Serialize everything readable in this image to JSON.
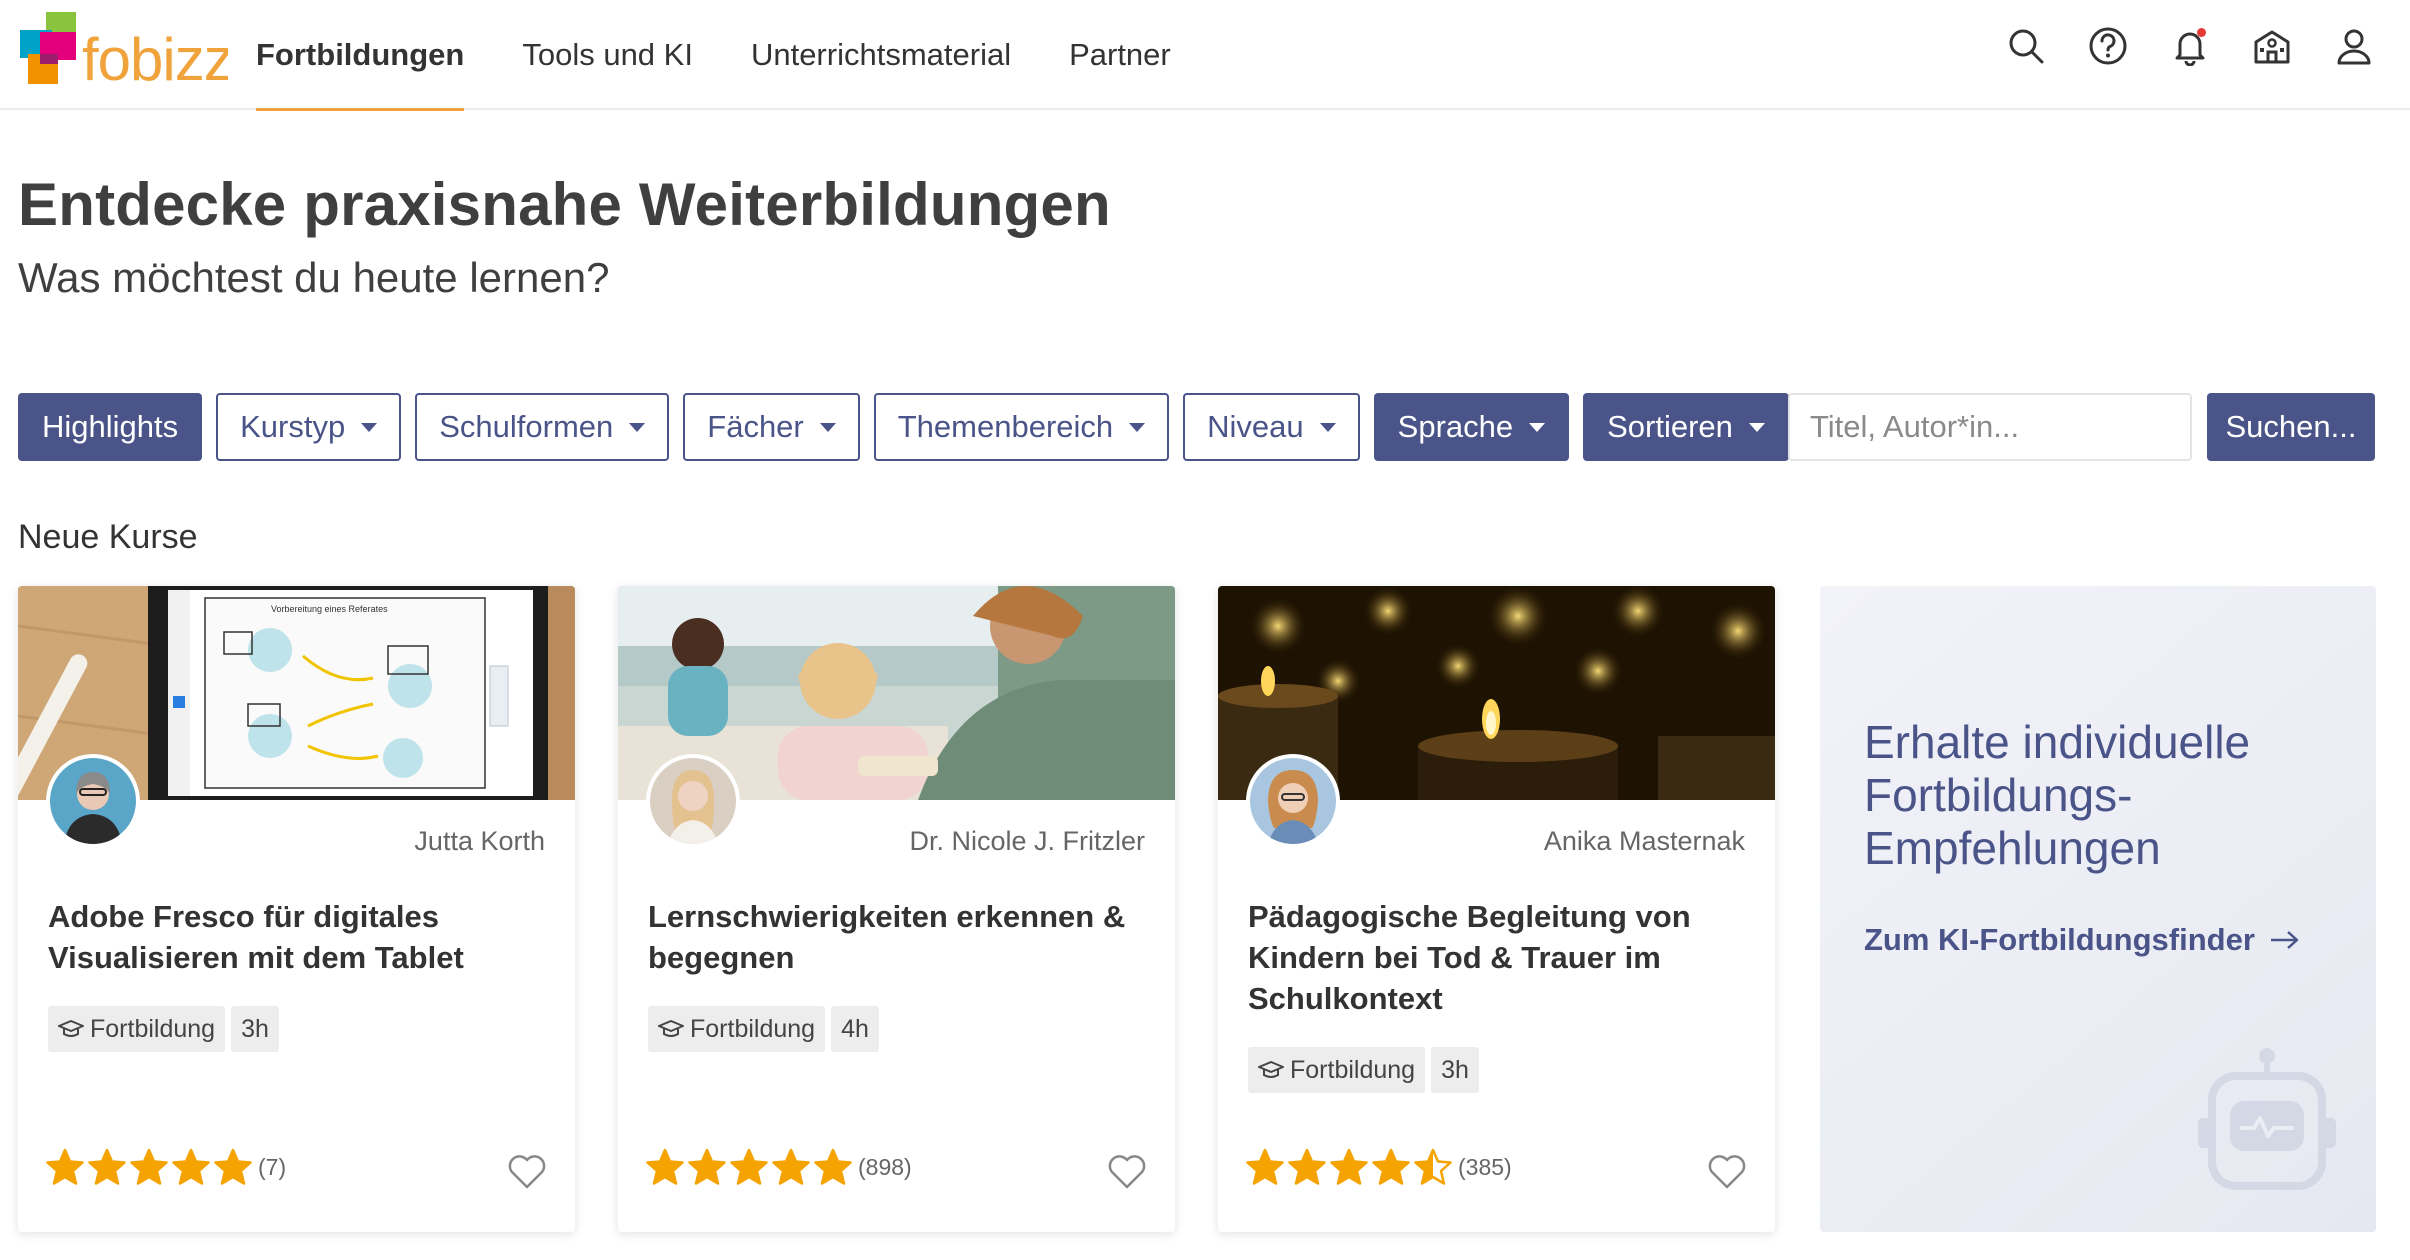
{
  "brand": {
    "name": "fobizz",
    "accent": "#f0a33a",
    "primary": "#4a5488"
  },
  "nav": {
    "items": [
      {
        "label": "Fortbildungen",
        "active": true
      },
      {
        "label": "Tools und KI",
        "active": false
      },
      {
        "label": "Unterrichtsmaterial",
        "active": false
      },
      {
        "label": "Partner",
        "active": false
      }
    ],
    "icons": [
      "search-icon",
      "help-icon",
      "bell-icon",
      "school-icon",
      "user-icon"
    ]
  },
  "hero": {
    "title": "Entdecke praxisnahe Weiterbildungen",
    "subtitle": "Was möchtest du heute lernen?"
  },
  "filters": {
    "highlights": "Highlights",
    "kurstyp": "Kurstyp",
    "schulformen": "Schulformen",
    "faecher": "Fächer",
    "themenbereich": "Themenbereich",
    "niveau": "Niveau",
    "sprache": "Sprache",
    "sortieren": "Sortieren"
  },
  "search": {
    "placeholder": "Titel, Autor*in...",
    "button": "Suchen..."
  },
  "section": {
    "title": "Neue Kurse"
  },
  "courses": [
    {
      "author": "Jutta Korth",
      "title": "Adobe Fresco für digitales Visualisieren mit dem Tablet",
      "type": "Fortbildung",
      "duration": "3h",
      "rating": 5,
      "rating_count": "(7)"
    },
    {
      "author": "Dr. Nicole J. Fritzler",
      "title": "Lernschwierigkeiten erkennen & begegnen",
      "type": "Fortbildung",
      "duration": "4h",
      "rating": 5,
      "rating_count": "(898)"
    },
    {
      "author": "Anika Masternak",
      "title": "Pädagogische Begleitung von Kindern bei Tod & Trauer im Schulkontext",
      "type": "Fortbildung",
      "duration": "3h",
      "rating": 4.5,
      "rating_count": "(385)"
    }
  ],
  "promo": {
    "title": "Erhalte individuelle Fortbildungs-Empfehlungen",
    "link": "Zum KI-Fortbildungsfinder"
  },
  "thumbnail_texts": {
    "sketch_title": "Vorbereitung eines Referates"
  }
}
